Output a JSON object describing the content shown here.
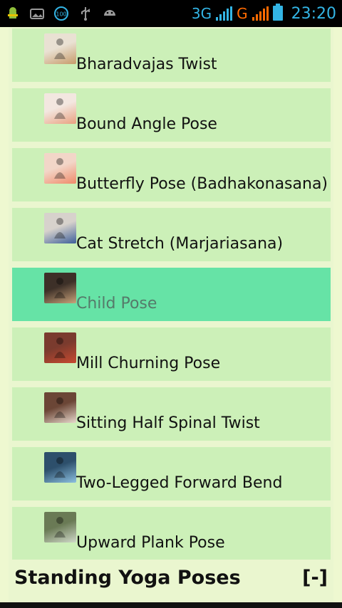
{
  "status_bar": {
    "left_icons": [
      "android-debug-icon",
      "image-icon",
      "battery-100-icon",
      "usb-icon",
      "android-icon"
    ],
    "network_3g": "3G",
    "network_g": "G",
    "time": "23:20"
  },
  "poses": [
    {
      "label": "Bharadvajas Twist",
      "thumb": "yoga-pose-thumbnail",
      "colors": [
        "#e9e1d3",
        "#c79b6a"
      ]
    },
    {
      "label": "Bound Angle Pose",
      "thumb": "yoga-pose-thumbnail",
      "colors": [
        "#f3e7e0",
        "#e9a080"
      ]
    },
    {
      "label": "Butterfly Pose (Badhakonasana)",
      "thumb": "yoga-pose-thumbnail",
      "colors": [
        "#f2d6c8",
        "#f08a6a"
      ]
    },
    {
      "label": "Cat Stretch (Marjariasana)",
      "thumb": "yoga-pose-thumbnail",
      "colors": [
        "#d7d2cc",
        "#3d5f9a"
      ]
    },
    {
      "label": "Child Pose",
      "thumb": "yoga-pose-thumbnail",
      "colors": [
        "#3d3028",
        "#c9a27a"
      ]
    },
    {
      "label": "Mill Churning Pose",
      "thumb": "yoga-pose-thumbnail",
      "colors": [
        "#7a3b2e",
        "#c84a30"
      ]
    },
    {
      "label": "Sitting Half Spinal Twist",
      "thumb": "yoga-pose-thumbnail",
      "colors": [
        "#6b4636",
        "#e7d8cc"
      ]
    },
    {
      "label": "Two-Legged Forward Bend",
      "thumb": "yoga-pose-thumbnail",
      "colors": [
        "#2d4f6b",
        "#8cc0e0"
      ]
    },
    {
      "label": "Upward Plank Pose",
      "thumb": "yoga-pose-thumbnail",
      "colors": [
        "#6a7a55",
        "#cfd8c8"
      ]
    }
  ],
  "selected_index": 4,
  "section": {
    "title": "Standing Yoga Poses",
    "toggle": "[-]"
  }
}
